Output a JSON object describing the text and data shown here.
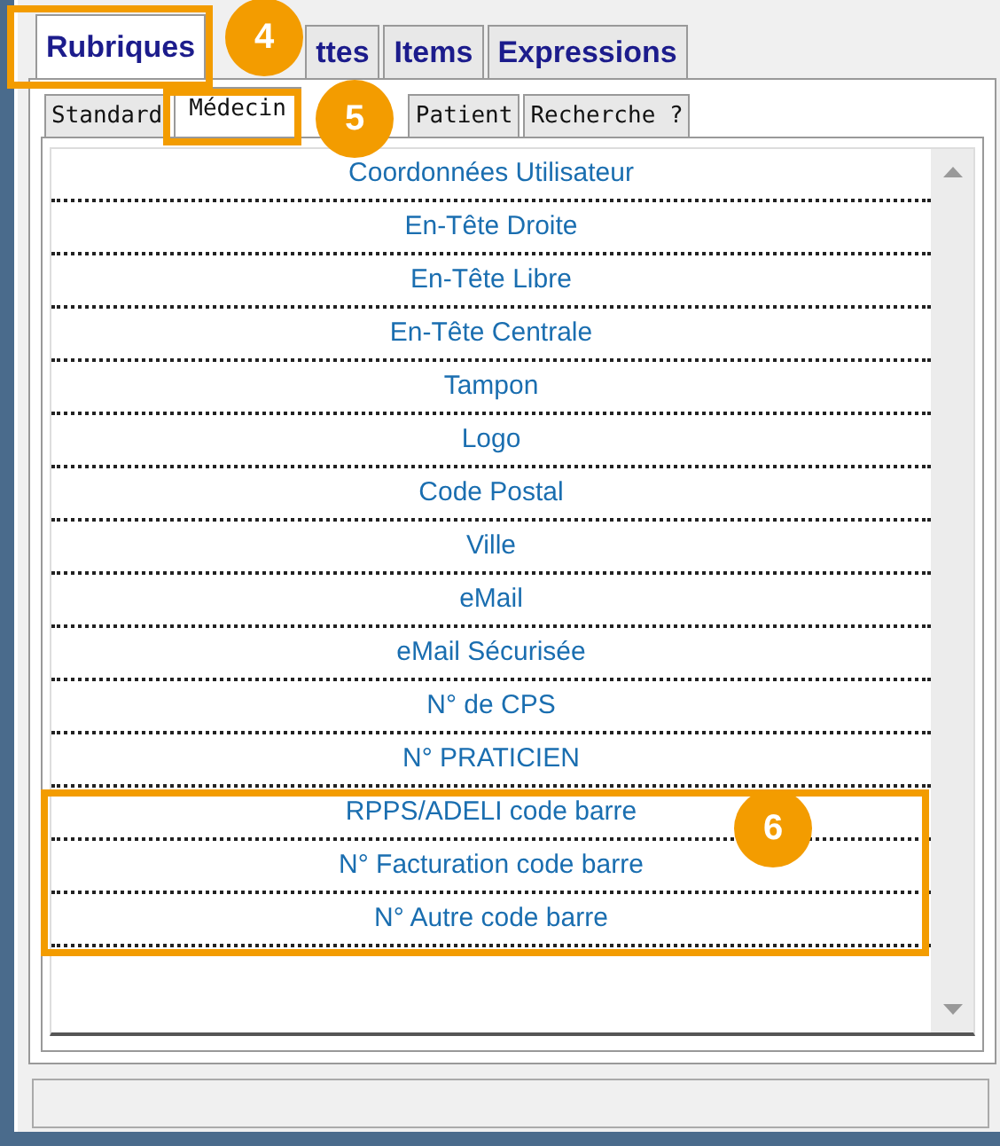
{
  "tabs": [
    {
      "label": "Rubriques",
      "selected": true
    },
    {
      "label": "ttes",
      "covered": true,
      "selected": false
    },
    {
      "label": "Items",
      "selected": false
    },
    {
      "label": "Expressions",
      "selected": false
    }
  ],
  "subtabs": [
    {
      "label": "Standard",
      "selected": false
    },
    {
      "label": "Médecin",
      "selected": true
    },
    {
      "label": "Patient",
      "selected": false
    },
    {
      "label": "Recherche ?",
      "selected": false
    }
  ],
  "items": [
    {
      "label": "Coordonnées Utilisateur"
    },
    {
      "label": "En-Tête Droite"
    },
    {
      "label": "En-Tête Libre"
    },
    {
      "label": "En-Tête Centrale"
    },
    {
      "label": "Tampon"
    },
    {
      "label": "Logo"
    },
    {
      "label": "Code Postal"
    },
    {
      "label": "Ville"
    },
    {
      "label": "eMail"
    },
    {
      "label": "eMail Sécurisée"
    },
    {
      "label": "N° de CPS"
    },
    {
      "label": "N° PRATICIEN"
    },
    {
      "label": "RPPS/ADELI code barre"
    },
    {
      "label": "N° Facturation code barre"
    },
    {
      "label": "N° Autre code barre"
    }
  ],
  "callouts": [
    {
      "number": "4"
    },
    {
      "number": "5"
    },
    {
      "number": "6"
    }
  ]
}
